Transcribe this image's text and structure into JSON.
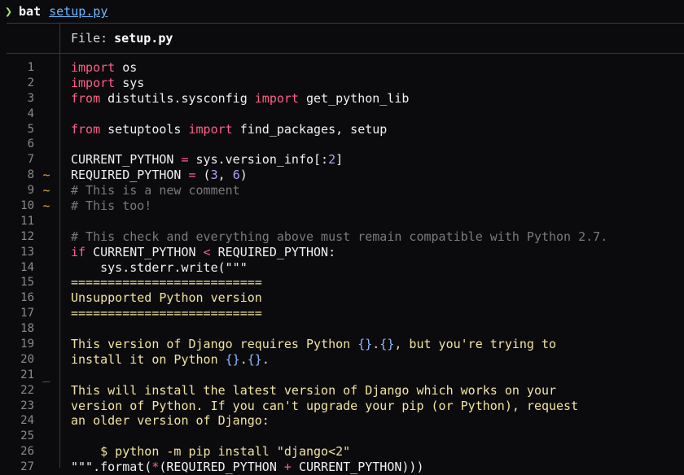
{
  "terminal": {
    "prompt_symbol": "❯",
    "command": "bat",
    "argument": "setup.py"
  },
  "viewer": {
    "file_label": "File:",
    "file_name": "setup.py"
  },
  "lines": [
    {
      "n": "1",
      "mark": "",
      "text": "import os"
    },
    {
      "n": "2",
      "mark": "",
      "text": "import sys"
    },
    {
      "n": "3",
      "mark": "",
      "text": "from distutils.sysconfig import get_python_lib"
    },
    {
      "n": "4",
      "mark": "",
      "text": ""
    },
    {
      "n": "5",
      "mark": "",
      "text": "from setuptools import find_packages, setup"
    },
    {
      "n": "6",
      "mark": "",
      "text": ""
    },
    {
      "n": "7",
      "mark": "",
      "text": "CURRENT_PYTHON = sys.version_info[:2]"
    },
    {
      "n": "8",
      "mark": "~",
      "text": "REQUIRED_PYTHON = (3, 6)"
    },
    {
      "n": "9",
      "mark": "~",
      "text": "# This is a new comment"
    },
    {
      "n": "10",
      "mark": "~",
      "text": "# This too!"
    },
    {
      "n": "11",
      "mark": "",
      "text": ""
    },
    {
      "n": "12",
      "mark": "",
      "text": "# This check and everything above must remain compatible with Python 2.7."
    },
    {
      "n": "13",
      "mark": "",
      "text": "if CURRENT_PYTHON < REQUIRED_PYTHON:"
    },
    {
      "n": "14",
      "mark": "",
      "text": "    sys.stderr.write(\"\"\""
    },
    {
      "n": "15",
      "mark": "",
      "text": "=========================="
    },
    {
      "n": "16",
      "mark": "",
      "text": "Unsupported Python version"
    },
    {
      "n": "17",
      "mark": "",
      "text": "=========================="
    },
    {
      "n": "18",
      "mark": "",
      "text": ""
    },
    {
      "n": "19",
      "mark": "",
      "text": "This version of Django requires Python {}.{}, but you're trying to"
    },
    {
      "n": "20",
      "mark": "",
      "text": "install it on Python {}.{}."
    },
    {
      "n": "21",
      "mark": "_",
      "text": ""
    },
    {
      "n": "22",
      "mark": "",
      "text": "This will install the latest version of Django which works on your"
    },
    {
      "n": "23",
      "mark": "",
      "text": "version of Python. If you can't upgrade your pip (or Python), request"
    },
    {
      "n": "24",
      "mark": "",
      "text": "an older version of Django:"
    },
    {
      "n": "25",
      "mark": "",
      "text": ""
    },
    {
      "n": "26",
      "mark": "",
      "text": "    $ python -m pip install \"django<2\""
    },
    {
      "n": "27",
      "mark": "",
      "text": "\"\"\".format(*(REQUIRED_PYTHON + CURRENT_PYTHON)))"
    }
  ],
  "colors": {
    "keyword": "#ff5f87",
    "comment": "#7a7a7a",
    "number": "#b79cff",
    "string": "#f2e3a0",
    "modified_marker": "#d9a441",
    "deleted_marker": "#e15a5a",
    "prompt": "#9fe870",
    "link": "#6fb7ff"
  }
}
